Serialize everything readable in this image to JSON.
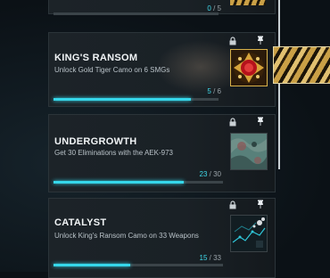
{
  "top_card": {
    "progress_current": "0",
    "progress_sep": " / ",
    "progress_total": "5"
  },
  "cards": [
    {
      "title": "KING'S RANSOM",
      "description": "Unlock Gold Tiger Camo on 6 SMGs",
      "progress_current": "5",
      "progress_sep": " / ",
      "progress_total": "6",
      "progress": 0.833,
      "thumb_icon": "red-gem-ornament-icon"
    },
    {
      "title": "UNDERGROWTH",
      "description": "Get 30 Eliminations with the AEK-973",
      "progress_current": "23",
      "progress_sep": " / ",
      "progress_total": "30",
      "progress": 0.767,
      "thumb_icon": "camo-pattern-icon"
    },
    {
      "title": "CATALYST",
      "description": "Unlock King's Ransom Camo on 33 Weapons",
      "progress_current": "15",
      "progress_sep": " / ",
      "progress_total": "33",
      "progress": 0.455,
      "thumb_icon": "cyber-circuit-icon"
    }
  ],
  "icons": {
    "lock": "lock-icon",
    "pin": "pin-icon"
  },
  "colors": {
    "accent": "#36d7ea",
    "background": "#0b1116"
  }
}
